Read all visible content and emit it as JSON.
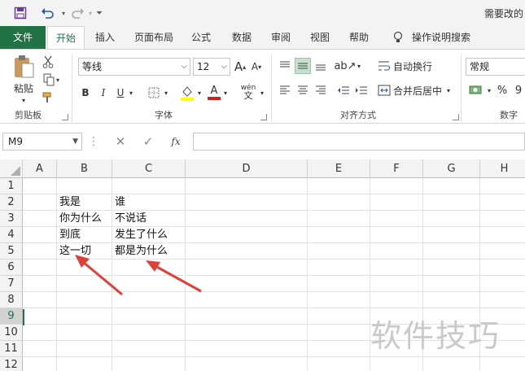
{
  "window": {
    "doc_title": "需要改的"
  },
  "tabs": [
    {
      "label": "文件"
    },
    {
      "label": "开始"
    },
    {
      "label": "插入"
    },
    {
      "label": "页面布局"
    },
    {
      "label": "公式"
    },
    {
      "label": "数据"
    },
    {
      "label": "审阅"
    },
    {
      "label": "视图"
    },
    {
      "label": "帮助"
    },
    {
      "label": "操作说明搜索"
    }
  ],
  "clipboard": {
    "paste_label": "粘贴",
    "group_label": "剪贴板"
  },
  "font": {
    "name": "等线",
    "size": "12",
    "bold": "B",
    "italic": "I",
    "underline": "U",
    "font_color_letter": "A",
    "phonetic": "wén",
    "group_label": "字体",
    "grow": "A",
    "shrink": "A"
  },
  "alignment": {
    "wrap_text": "自动换行",
    "merge_center": "合并后居中",
    "group_label": "对齐方式"
  },
  "number": {
    "format": "常规",
    "percent": "%",
    "comma": "9",
    "group_label": "数字"
  },
  "formula_bar": {
    "name_box": "M9",
    "fx": "fx",
    "value": ""
  },
  "columns": [
    "A",
    "B",
    "C",
    "D",
    "E",
    "F",
    "G",
    "H"
  ],
  "rows": [
    "1",
    "2",
    "3",
    "4",
    "5",
    "6",
    "7",
    "8",
    "9",
    "10",
    "11",
    "12"
  ],
  "active_row": "9",
  "cells": [
    {
      "ref": "B2",
      "value": "我是"
    },
    {
      "ref": "C2",
      "value": "谁"
    },
    {
      "ref": "B3",
      "value": "你为什么"
    },
    {
      "ref": "C3",
      "value": "不说话"
    },
    {
      "ref": "B4",
      "value": "到底"
    },
    {
      "ref": "C4",
      "value": "发生了什么"
    },
    {
      "ref": "B5",
      "value": "这一切"
    },
    {
      "ref": "C5",
      "value": "都是为什么"
    }
  ],
  "watermark": "软件技巧",
  "colors": {
    "accent": "#217346",
    "arrow": "#e0403a",
    "fill_yellow": "#ffff00",
    "font_red": "#d0201a"
  }
}
